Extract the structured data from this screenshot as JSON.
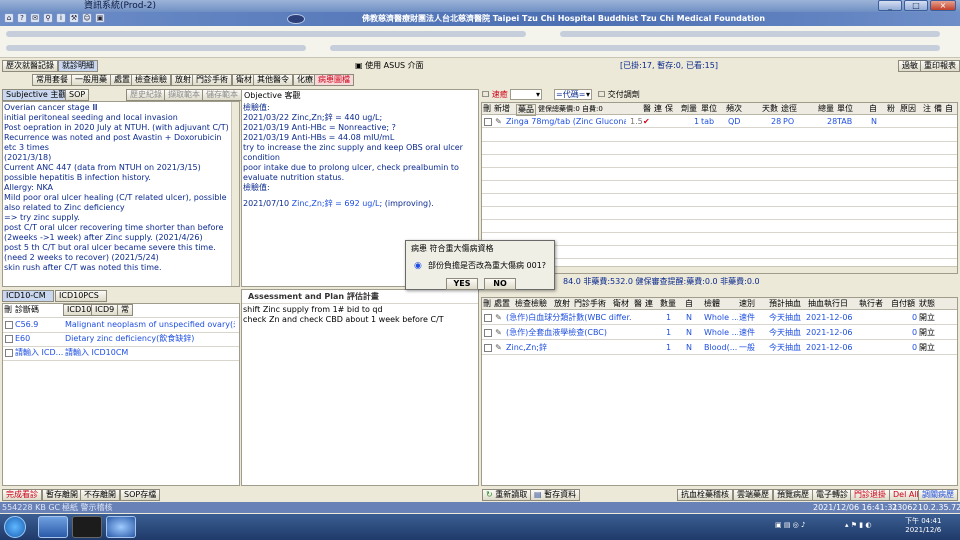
{
  "window": {
    "title": "資訊系統(Prod-2)",
    "buttons": [
      "_",
      "□",
      "×"
    ]
  },
  "banner": {
    "hospital": "佛教慈濟醫療財團法人台北慈濟醫院 Taipei Tzu Chi Hospital Buddhist Tzu Chi Medical Foundation"
  },
  "toolbar_row": {
    "tab_history": "歷次就醫記錄",
    "tab_summary": "就診明細",
    "use_asus": "使用 ASUS 介面",
    "counts": "[已掛:17, 暫存:0, 已看:15]",
    "pass_button": "過敏",
    "reprint_button": "重印報表"
  },
  "category_buttons": [
    "常用套餐",
    "一般用藥",
    "處置",
    "檢查檢驗",
    "放射",
    "門診手術",
    "衛材",
    "其他醫令",
    "化療",
    "病患圖檔"
  ],
  "subjective": {
    "tab_main": "Subjective 主觀",
    "tab_sop": "SOP",
    "btn_history": "歷史紀錄",
    "btn_fetch": "擷取範本",
    "btn_save": "儲存範本",
    "text": "Overian cancer stage Ⅲ\ninitial peritoneal seeding and local invasion\nPost oepration in 2020 July at NTUH. (with adjuvant C/T)\nRecurrence was noted and post Avastin + Doxorubicin etc 3 times\n(2021/3/18)\nCurrent ANC 447 (data from NTUH on 2021/3/15)\npossible hepatitis B infection history.\nAllergy: NKA\nMild poor oral ulcer healing (C/T related ulcer), possible also related to Zinc deficiency\n=> try zinc supply.\npost C/T oral ulcer recovering time shorter than before (2weeks ->1 week) after Zinc supply. (2021/4/26)\npost 5 th C/T but oral ulcer became severe this time. (need 2 weeks to recover) (2021/5/24)\nskin rush after C/T was noted this time."
  },
  "objective": {
    "title": "Objective 客觀",
    "lines_before": "檢驗值:\n2021/03/22 Zinc,Zn;鋅 = 440 ug/L;\n2021/03/19 Anti-HBc = Nonreactive; ?\n2021/03/19 Anti-HBs = 44.08 mIU/mL\ntry to increase the zinc supply and keep OBS oral ulcer condition\npoor intake due to prolong ulcer, check prealbumin to evaluate nutrition status.\n檢驗值:",
    "last_line_date": "2021/07/10 ",
    "last_line_highlight": "Zinc,Zn;鋅 = 692 ug/L",
    "last_line_suffix": "; (improving)."
  },
  "icd": {
    "tab1": "ICD10-CM",
    "tab2": "ICD10PCS",
    "headers": [
      "刪",
      "診斷碼",
      "ICD10",
      "ICD9",
      "常"
    ],
    "rows": [
      {
        "code": "C56.9",
        "desc": "Malignant neoplasm of unspecified ovary(未明..."
      },
      {
        "code": "E60",
        "desc": "Dietary zinc deficiency(飲食缺鋅)"
      },
      {
        "code": "請輸入 ICD...",
        "desc": "請輸入 ICD10CM"
      }
    ]
  },
  "assessment": {
    "title": "Assessment and Plan 評估計畫",
    "text": "shift Zinc supply from 1# bid to qd\ncheck Zn and check CBD about 1 week before C/T"
  },
  "med_filter": {
    "urgent": "速癒",
    "search": "=代碼=",
    "print_label": "交付調劑"
  },
  "med_table": {
    "headers": [
      "刪",
      "新增",
      "藥品",
      "健保總藥價:0 自費:0",
      "醫",
      "連",
      "保",
      "劑量",
      "單位",
      "頻次",
      "天數",
      "途徑",
      "總量",
      "單位",
      "自",
      "粉",
      "原因",
      "注",
      "備",
      "自"
    ],
    "rows": [
      {
        "name": "Zinga 78mg/tab (Zinc Gluconate)",
        "price": "1.5",
        "dose": "1",
        "unit": "tab",
        "freq": "QD",
        "days": "28",
        "route": "PO",
        "total": "28",
        "tunit": "TAB",
        "self": "N"
      }
    ]
  },
  "mid_summary": {
    "text": "84.0 非藥費:532.0 健保審查提醒:藥費:0.0 非藥費:0.0"
  },
  "order_table": {
    "headers": [
      "刪",
      "處置",
      "檢查檢驗",
      "放射",
      "門診手術",
      "衛材",
      "醫",
      "連",
      "數量",
      "自",
      "檢體",
      "速別",
      "預計抽血",
      "抽血執行日",
      "執行者",
      "自付額",
      "狀態"
    ],
    "rows": [
      {
        "name": "(急作)白血球分類計數(WBC differ...",
        "qty": "1",
        "self": "N",
        "specimen": "Whole ...",
        "speed": "速件",
        "plan": "今天抽血",
        "date": "2021-12-06",
        "amount": "0",
        "status": "開立"
      },
      {
        "name": "(急作)全套血液學檢查(CBC)",
        "qty": "1",
        "self": "N",
        "specimen": "Whole ...",
        "speed": "速件",
        "plan": "今天抽血",
        "date": "2021-12-06",
        "amount": "0",
        "status": "開立"
      },
      {
        "name": "Zinc,Zn;鋅",
        "qty": "1",
        "self": "N",
        "specimen": "Blood(...",
        "speed": "一般",
        "plan": "今天抽血",
        "date": "2021-12-06",
        "amount": "0",
        "status": "開立"
      }
    ]
  },
  "dialog": {
    "title": "病患  符合重大傷病資格",
    "message": "部份負擔是否改為重大傷病 001?",
    "yes": "YES",
    "no": "NO"
  },
  "bottom_left_buttons": [
    "完成看診",
    "暫存離開",
    "不存離開",
    "SOP存檔"
  ],
  "bottom_right_buttons": {
    "reload": "重新讀取",
    "temp_save": "暫存資料",
    "others": [
      "抗血栓藥稽核",
      "雲端藥歷",
      "預覽病歷",
      "電子轉診",
      "門診退掛",
      "Del All",
      "調關病歷"
    ]
  },
  "status_bar": {
    "left": "554228 KB  GC",
    "middle": "極紙  警示稽核",
    "datetime": "2021/12/06  16:41:31",
    "code": "23062",
    "ip": "10.2.35.72"
  },
  "taskbar": {
    "time": "下午 04:41",
    "date": "2021/12/6"
  },
  "colors": {
    "accent_blue": "#0b2a8f",
    "red": "#d0021b",
    "banner": "#4c6fb3"
  }
}
